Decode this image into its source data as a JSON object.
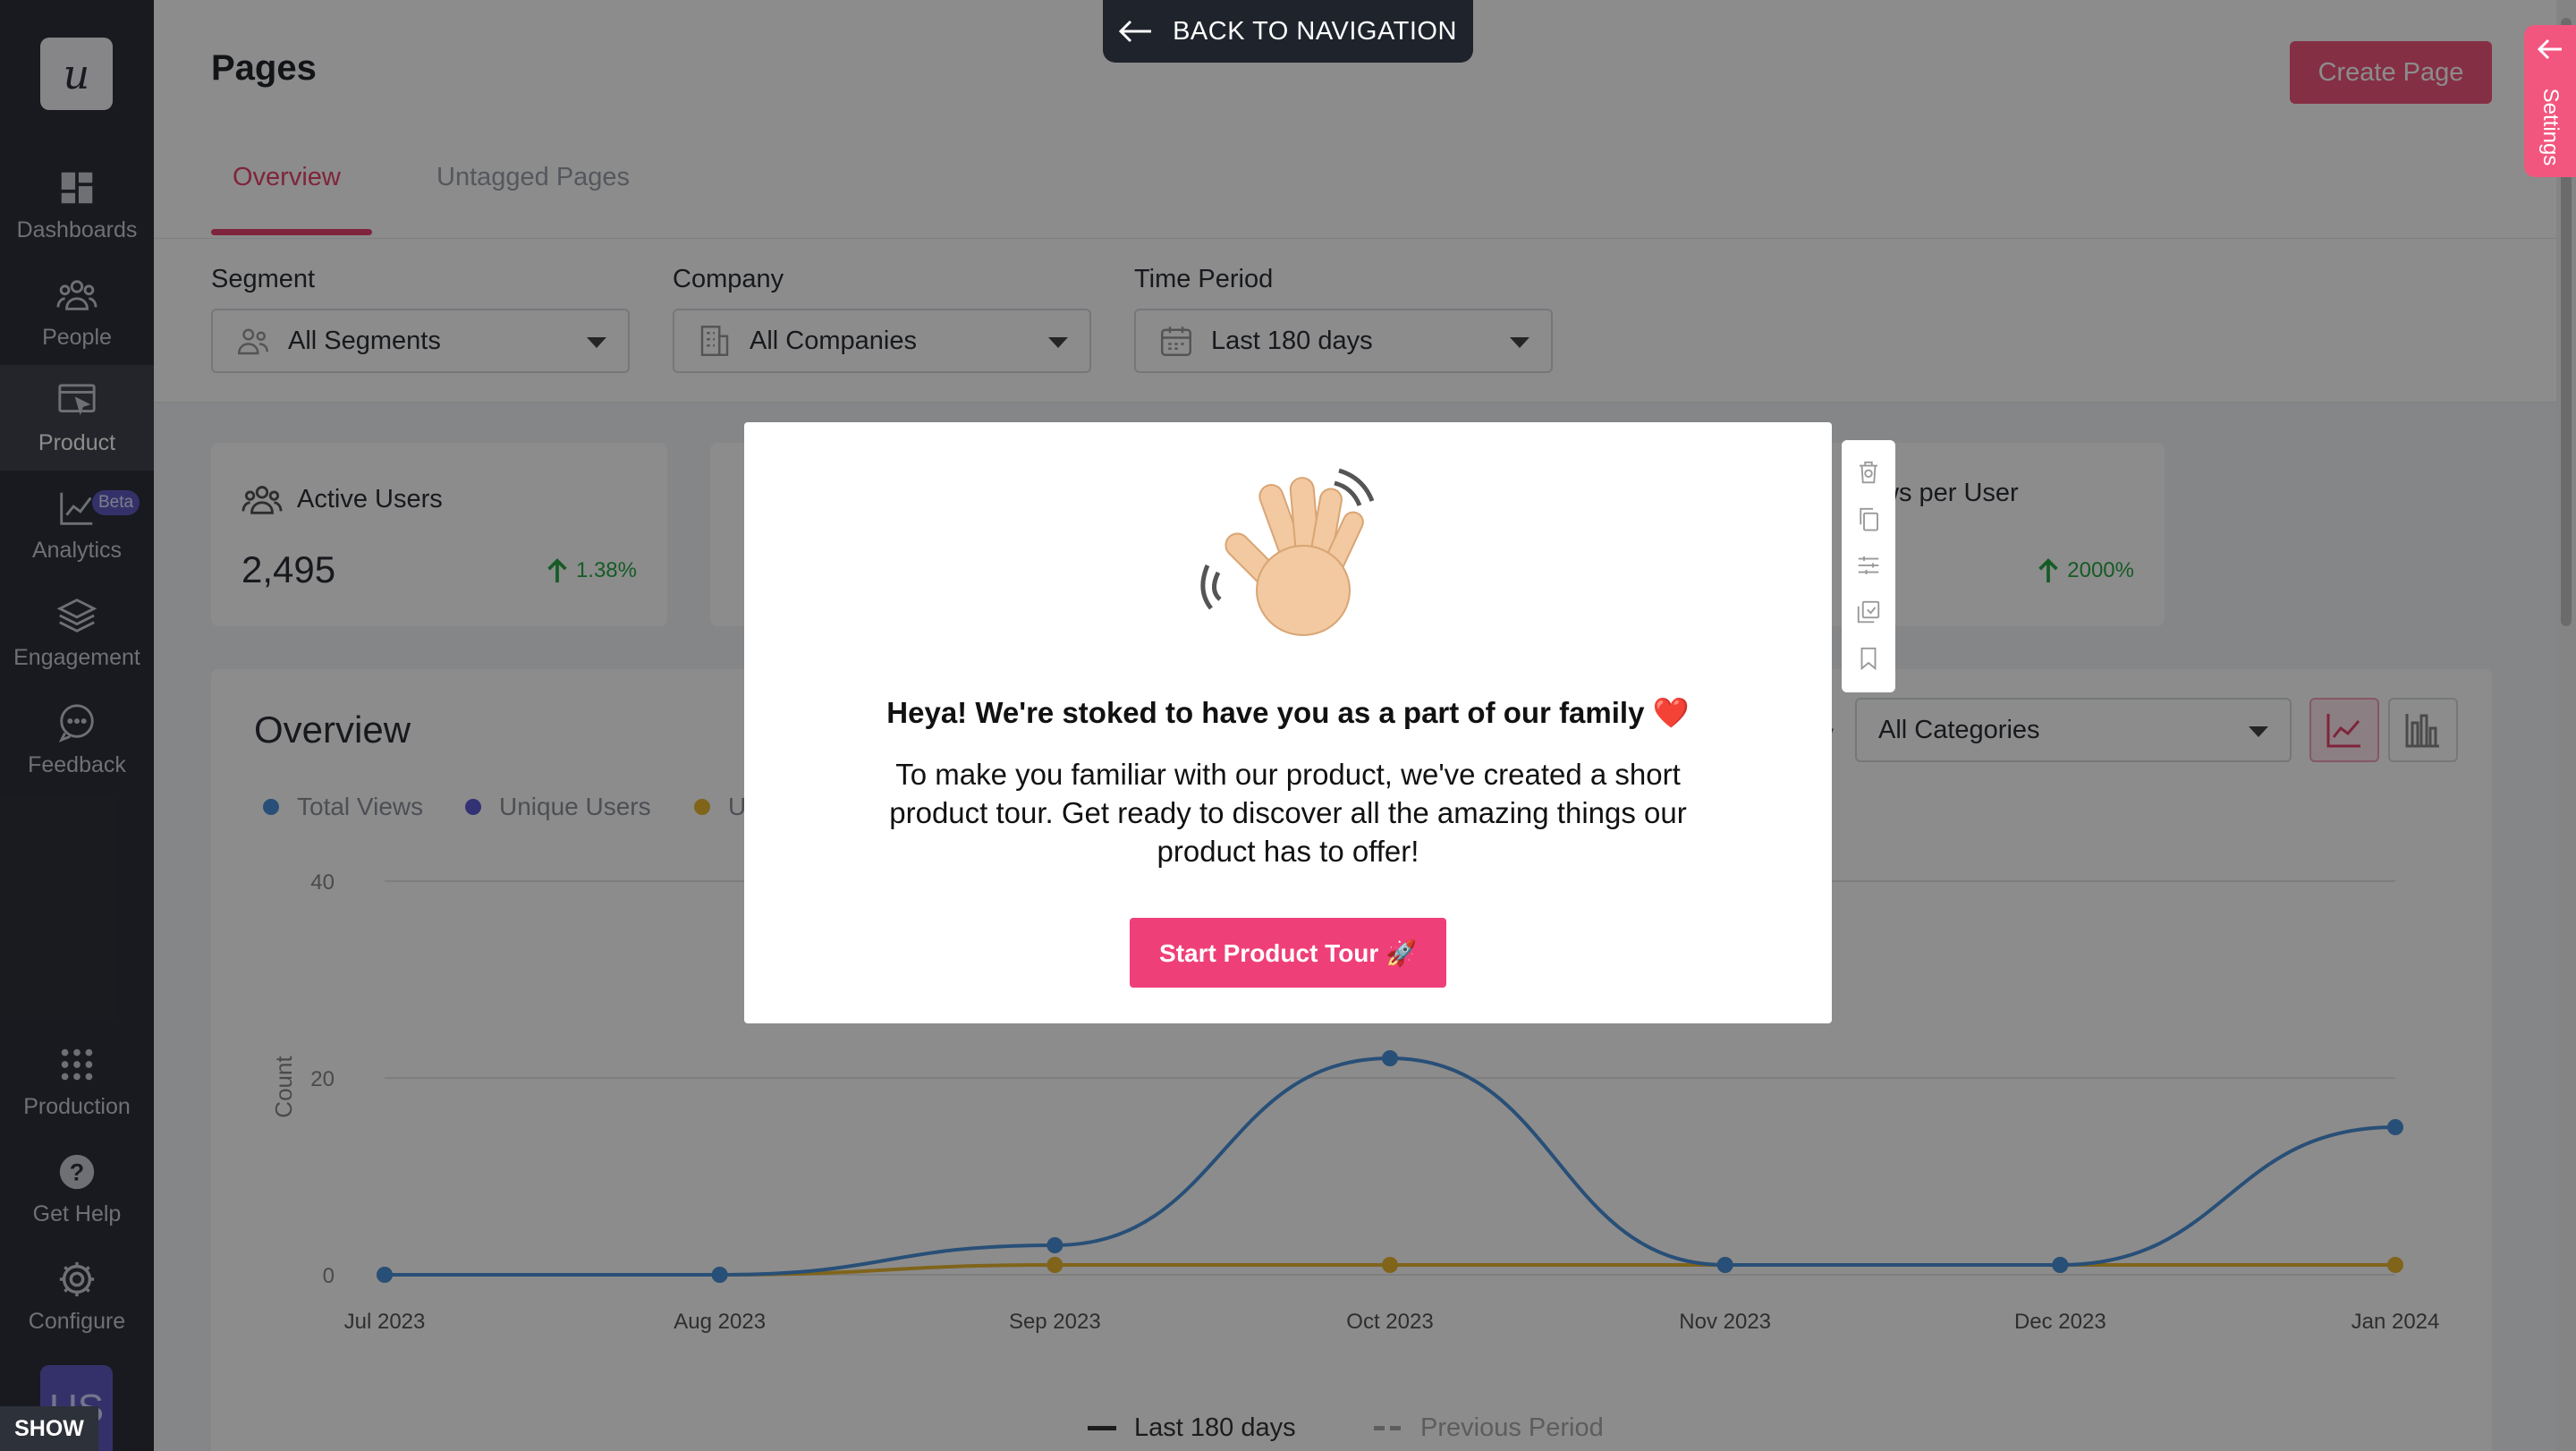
{
  "back_navigation": "BACK TO NAVIGATION",
  "settings_tab": "Settings",
  "show_label": "SHOW",
  "sidebar": {
    "logo": "u",
    "items": [
      {
        "label": "Dashboards",
        "icon": "dashboard-icon"
      },
      {
        "label": "People",
        "icon": "people-icon"
      },
      {
        "label": "Product",
        "icon": "product-icon"
      },
      {
        "label": "Analytics",
        "icon": "analytics-icon",
        "badge": "Beta"
      },
      {
        "label": "Engagement",
        "icon": "layers-icon"
      },
      {
        "label": "Feedback",
        "icon": "chat-icon"
      },
      {
        "label": "Production",
        "icon": "grid-icon"
      },
      {
        "label": "Get Help",
        "icon": "help-icon"
      },
      {
        "label": "Configure",
        "icon": "gear-icon"
      }
    ],
    "active": "Product",
    "avatar_initials": "US"
  },
  "header": {
    "title": "Pages",
    "create_button": "Create Page",
    "tabs": [
      "Overview",
      "Untagged Pages"
    ]
  },
  "filters": {
    "segment": {
      "label": "Segment",
      "value": "All Segments"
    },
    "company": {
      "label": "Company",
      "value": "All Companies"
    },
    "time_period": {
      "label": "Time Period",
      "value": "Last 180 days"
    }
  },
  "cards": {
    "active_users": {
      "title": "Active Users",
      "value": "2,495",
      "delta": "1.38%"
    },
    "views_per_user": {
      "title": "ws per User",
      "delta": "2000%"
    }
  },
  "overview": {
    "title": "Overview",
    "category_prefix": "y",
    "category_value": "All Categories",
    "legend": [
      "Total Views",
      "Unique Users",
      "U"
    ],
    "bottom_legend": [
      "Last 180 days",
      "Previous Period"
    ]
  },
  "colors": {
    "accent": "#e8426e",
    "total_views": "#4a90d9",
    "unique_users": "#5b5bd6",
    "third_series": "#e8b730"
  },
  "chart_data": {
    "type": "line",
    "x": [
      "Jul 2023",
      "Aug 2023",
      "Sep 2023",
      "Oct 2023",
      "Nov 2023",
      "Dec 2023",
      "Jan 2024"
    ],
    "ylabel": "Count",
    "ylim": [
      0,
      40
    ],
    "yticks": [
      0,
      20,
      40
    ],
    "series": [
      {
        "name": "Total Views",
        "values": [
          0,
          0,
          3,
          22,
          1,
          1,
          15
        ]
      },
      {
        "name": "Unique Users",
        "values": [
          0,
          0,
          1,
          1,
          1,
          1,
          1
        ]
      }
    ]
  },
  "modal": {
    "heading": "Heya! We're stoked to have you as a part of our family ❤️",
    "body": "To make you familiar with our product, we've created a short product tour. Get ready to discover all the amazing things our product has to offer!",
    "button": "Start Product Tour 🚀"
  }
}
